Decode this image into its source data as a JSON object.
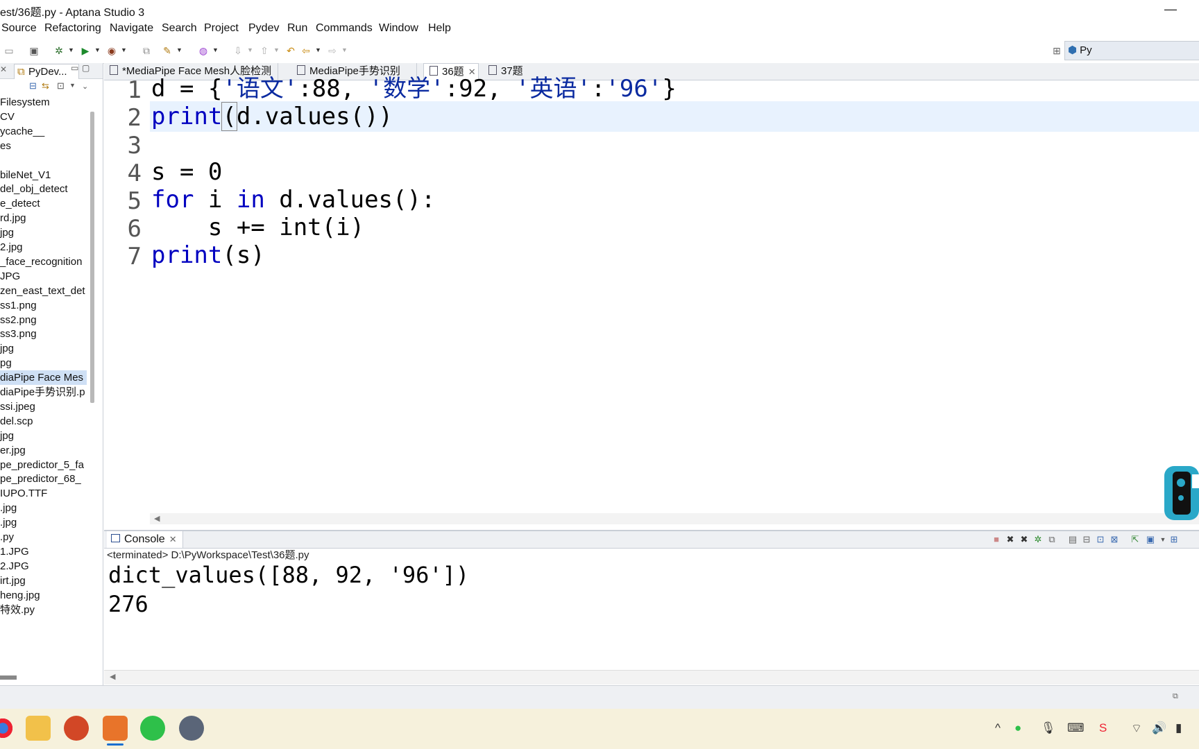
{
  "window": {
    "title": "est/36题.py - Aptana Studio 3",
    "minimize_glyph": "—"
  },
  "menu": [
    "Source",
    "Refactoring",
    "Navigate",
    "Search",
    "Project",
    "Pydev",
    "Run",
    "Commands",
    "Window",
    "Help"
  ],
  "perspective": {
    "label": "Py"
  },
  "left_panel": {
    "tab_label": "PyDev...",
    "items": [
      "Filesystem",
      "CV",
      "ycache__",
      "es",
      "",
      "bileNet_V1",
      "del_obj_detect",
      "e_detect",
      "rd.jpg",
      "jpg",
      "2.jpg",
      "_face_recognition",
      "JPG",
      "zen_east_text_det",
      "ss1.png",
      "ss2.png",
      "ss3.png",
      "jpg",
      "pg",
      "diaPipe Face Mes",
      "diaPipe手势识别.p",
      "ssi.jpeg",
      "del.scp",
      "jpg",
      "er.jpg",
      "pe_predictor_5_fa",
      "pe_predictor_68_",
      "IUPO.TTF",
      ".jpg",
      ".jpg",
      ".py",
      "1.JPG",
      "2.JPG",
      "irt.jpg",
      "heng.jpg",
      "特效.py"
    ],
    "selected_index": 19
  },
  "editor": {
    "tabs": [
      {
        "label": "*MediaPipe Face Mesh人脸检测",
        "active": false
      },
      {
        "label": "MediaPipe手势识别",
        "active": false
      },
      {
        "label": "36题",
        "active": true,
        "closable": true
      },
      {
        "label": "37题",
        "active": false
      }
    ],
    "line_numbers": [
      "1",
      "2",
      "3",
      "4",
      "5",
      "6",
      "7"
    ],
    "current_line": 2,
    "lines": {
      "l1": {
        "d": "d = {",
        "k1": "'语文'",
        "c1": ":88, ",
        "k2": "'数学'",
        "c2": ":92, ",
        "k3": "'英语'",
        "c3": ":",
        "v3": "'96'",
        "end": "}"
      },
      "l2": {
        "kw": "print",
        "paren": "(",
        "rest": "d.values())"
      },
      "l3": "",
      "l4": "s = 0",
      "l5": {
        "kw1": "for",
        "mid1": " i ",
        "kw2": "in",
        "rest": " d.values():"
      },
      "l6": "    s += int(i)",
      "l7": {
        "kw": "print",
        "rest": "(s)"
      }
    }
  },
  "console": {
    "tab_label": "Console",
    "status": "<terminated> D:\\PyWorkspace\\Test\\36题.py",
    "output": [
      "dict_values([88, 92, '96'])",
      "276"
    ]
  },
  "colors": {
    "keyword": "#0000c0",
    "string": "#0a2aa0",
    "current_line": "#e8f2fe",
    "selection": "#cfe0f5"
  }
}
